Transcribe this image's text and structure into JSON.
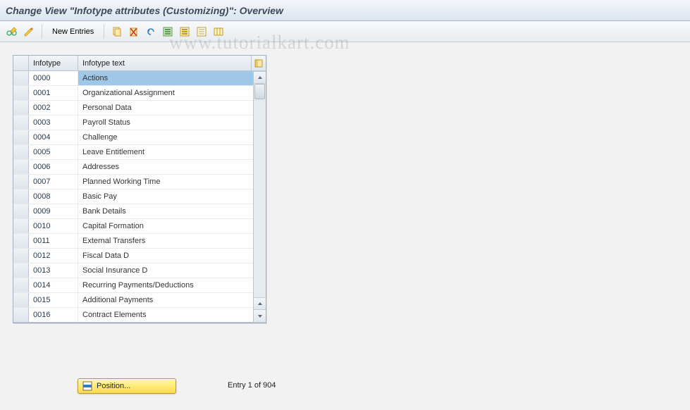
{
  "title": "Change View \"Infotype attributes (Customizing)\": Overview",
  "toolbar": {
    "new_entries_label": "New Entries"
  },
  "watermark": "www.tutorialkart.com",
  "table": {
    "headers": {
      "code": "Infotype",
      "text": "Infotype text"
    },
    "rows": [
      {
        "code": "0000",
        "text": "Actions",
        "selected": true
      },
      {
        "code": "0001",
        "text": "Organizational Assignment"
      },
      {
        "code": "0002",
        "text": "Personal Data"
      },
      {
        "code": "0003",
        "text": "Payroll Status"
      },
      {
        "code": "0004",
        "text": "Challenge"
      },
      {
        "code": "0005",
        "text": "Leave Entitlement"
      },
      {
        "code": "0006",
        "text": "Addresses"
      },
      {
        "code": "0007",
        "text": "Planned Working Time"
      },
      {
        "code": "0008",
        "text": "Basic Pay"
      },
      {
        "code": "0009",
        "text": "Bank Details"
      },
      {
        "code": "0010",
        "text": "Capital Formation"
      },
      {
        "code": "0011",
        "text": "External Transfers"
      },
      {
        "code": "0012",
        "text": "Fiscal Data  D"
      },
      {
        "code": "0013",
        "text": "Social Insurance  D"
      },
      {
        "code": "0014",
        "text": "Recurring Payments/Deductions"
      },
      {
        "code": "0015",
        "text": "Additional Payments"
      },
      {
        "code": "0016",
        "text": "Contract Elements"
      }
    ]
  },
  "footer": {
    "position_label": "Position...",
    "entry_text": "Entry 1 of 904"
  },
  "colors": {
    "selection": "#9ec7e8",
    "header": "#dbe4ee",
    "yellow_btn": "#ffe066"
  }
}
